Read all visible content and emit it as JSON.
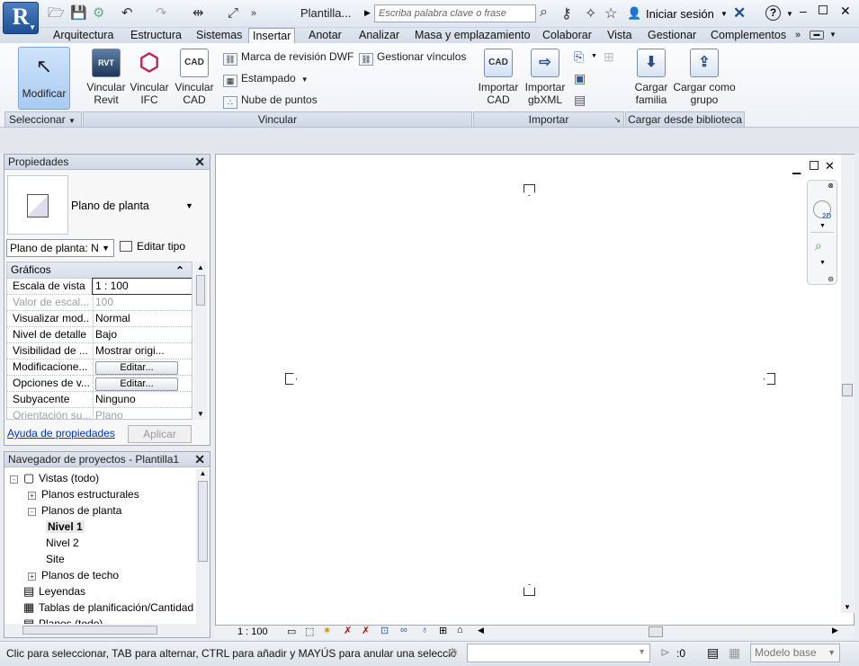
{
  "app": {
    "logo_letter": "R",
    "doc_title": "Plantilla...",
    "search_placeholder": "Escriba palabra clave o frase",
    "signin": "Iniciar sesión",
    "help": "?"
  },
  "tabs": [
    "Arquitectura",
    "Estructura",
    "Sistemas",
    "Insertar",
    "Anotar",
    "Analizar",
    "Masa y emplazamiento",
    "Colaborar",
    "Vista",
    "Gestionar",
    "Complementos"
  ],
  "active_tab": "Insertar",
  "ribbon": {
    "modificar": "Modificar",
    "vincular_revit": [
      "Vincular",
      "Revit"
    ],
    "vincular_ifc": [
      "Vincular",
      "IFC"
    ],
    "vincular_cad": [
      "Vincular",
      "CAD"
    ],
    "marca_dwf": "Marca de revisión DWF",
    "estampado": "Estampado",
    "nube": "Nube de puntos",
    "gestionar": "Gestionar vínculos",
    "importar_cad": [
      "Importar",
      "CAD"
    ],
    "importar_gbxml": [
      "Importar",
      "gbXML"
    ],
    "cargar_familia": [
      "Cargar",
      "familia"
    ],
    "cargar_grupo": [
      "Cargar como",
      "grupo"
    ],
    "cad_icon_label": "CAD",
    "rvt_icon_label": "RVT",
    "panels": {
      "seleccionar": "Seleccionar",
      "vincular": "Vincular",
      "importar": "Importar",
      "biblioteca": "Cargar desde biblioteca"
    }
  },
  "properties": {
    "title": "Propiedades",
    "type_name": "Plano de planta",
    "filter": "Plano de planta: N",
    "edit_type": "Editar tipo",
    "rows": [
      {
        "k": "Gráficos",
        "v": "",
        "cat": true
      },
      {
        "k": "Escala de vista",
        "v": "1 : 100"
      },
      {
        "k": "Valor de escal...",
        "v": "100",
        "dis": true
      },
      {
        "k": "Visualizar mod...",
        "v": "Normal"
      },
      {
        "k": "Nivel de detalle",
        "v": "Bajo"
      },
      {
        "k": "Visibilidad de ...",
        "v": "Mostrar origi..."
      },
      {
        "k": "Modificacione...",
        "v": "Editar...",
        "btn": true
      },
      {
        "k": "Opciones de v...",
        "v": "Editar...",
        "btn": true
      },
      {
        "k": "Subyacente",
        "v": "Ninguno"
      },
      {
        "k": "Orientación su...",
        "v": "Plano",
        "dis": true
      }
    ],
    "help_link": "Ayuda de propiedades",
    "apply": "Aplicar"
  },
  "navigator": {
    "title": "Navegador de proyectos - Plantilla1",
    "items": [
      {
        "t": "Vistas (todo)",
        "lvl": 0,
        "tg": "-"
      },
      {
        "t": "Planos estructurales",
        "lvl": 1,
        "tg": "+"
      },
      {
        "t": "Planos de planta",
        "lvl": 1,
        "tg": "-"
      },
      {
        "t": "Nivel 1",
        "lvl": 2,
        "bold": true
      },
      {
        "t": "Nivel 2",
        "lvl": 2
      },
      {
        "t": "Site",
        "lvl": 2
      },
      {
        "t": "Planos de techo",
        "lvl": 1,
        "tg": "+"
      },
      {
        "t": "Leyendas",
        "lvl": 0
      },
      {
        "t": "Tablas de planificación/Cantidad",
        "lvl": 0
      },
      {
        "t": "Planos (todo)",
        "lvl": 0
      }
    ]
  },
  "view": {
    "scale": "1 : 100",
    "nav_2d": "2D"
  },
  "status": {
    "text": "Clic para seleccionar, TAB para alternar, CTRL para añadir y MAYÚS para anular una selecció",
    "zero": ":0",
    "modelo": "Modelo base"
  }
}
